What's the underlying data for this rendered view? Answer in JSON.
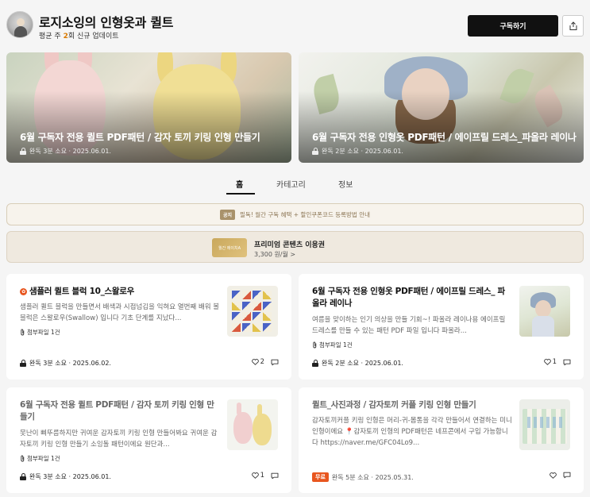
{
  "channel": {
    "title": "로지소잉의 인형옷과 퀼트",
    "update_prefix": "평균 주 ",
    "update_count": "2",
    "update_suffix": "회 신규 업데이트",
    "subscribe_label": "구독하기"
  },
  "banners": [
    {
      "title": "6월 구독자 전용 퀼트 PDF패턴 / 감자 토끼 키링 인형 만들기",
      "meta": "완독 3분 소요 · 2025.06.01."
    },
    {
      "title": "6월 구독자 전용 인형옷 PDF패턴 / 에이프릴 드레스_파올라 레이나",
      "meta": "완독 2분 소요 · 2025.06.01."
    }
  ],
  "tabs": [
    {
      "label": "홈",
      "active": true
    },
    {
      "label": "카테고리",
      "active": false
    },
    {
      "label": "정보",
      "active": false
    }
  ],
  "notice": {
    "badge": "공지",
    "text": "필독! 월간 구독 혜택 + 할인쿠폰코드 등록방법 안내"
  },
  "premium": {
    "thumb_label": "월간 에이치A",
    "title": "프리미엄 콘텐츠 이용권",
    "price": "3,300 원/월 >"
  },
  "cards": [
    {
      "title": "샘플러 퀼트 블럭 10_스왈로우",
      "excerpt": "샘플러 퀼트 블럭을 만들면서 배색과 시접넘김을 익혀요 열번째 배워 볼 블럭은 스왈로우(Swallow) 입니다 기초 단계를 지났다...",
      "attach": "첨부파일 1건",
      "meta": "완독 3분 소요 · 2025.06.02.",
      "likes": "2",
      "icon": "sampler-badge-icon"
    },
    {
      "title": "6월 구독자 전용 인형옷 PDF패턴 / 에이프릴 드레스_ 파올라 레이나",
      "excerpt": "여름을 맞이하는 인기 의상을 만들 기회~! 파올라 레이나용 에이프릴 드레스를 만들 수 있는 패턴 PDF 파일 입니다 파올라...",
      "attach": "첨부파일 1건",
      "meta": "완독 2분 소요 · 2025.06.01.",
      "likes": "1"
    },
    {
      "title": "6월 구독자 전용 퀼트 PDF패턴 / 감자 토끼 키링 인형 만들기",
      "excerpt": "못난이 삐뚜름하지만 귀여운 감자토끼 키링 인형 만들어봐요 귀여운 감자토끼 키링 인형 만들기 소잉돌 패턴이에요 원단과...",
      "attach": "첨부파일 1건",
      "meta": "완독 3분 소요 · 2025.06.01.",
      "likes": "1"
    },
    {
      "title": "퀼트_사진과정 / 감자토끼 커플 키링 인형 만들기",
      "excerpt": "감자토끼커플 키링 인형은 머리-귀-몸통을 각각 만들어서 연결하는 미니인형이에요 📍감자토끼 인형의 PDF패턴은 네프콘에서 구입 가능합니다 https://naver.me/GFC04Lo9...",
      "badge": "무료",
      "meta": "완독 5분 소요 · 2025.05.31.",
      "likes": ""
    }
  ],
  "colors": {
    "accent": "#e8561f",
    "primary_button": "#111111",
    "notice_text": "#8b7553"
  }
}
